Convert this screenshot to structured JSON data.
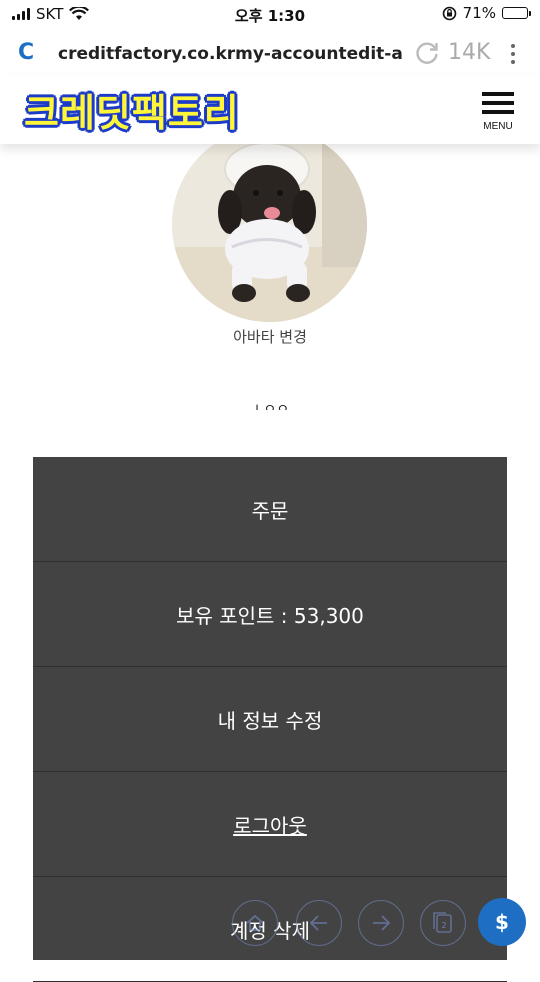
{
  "status_bar": {
    "carrier": "SKT",
    "time": "오후 1:30",
    "battery_percent": "71%",
    "battery_level": 0.71,
    "battery_color": "#3fc14b"
  },
  "browser": {
    "icon_letter": "C",
    "url": "creditfactory.co.krmy-accountedit-a",
    "tab_count": "14K",
    "reload_icon": "reload-icon",
    "more_icon": "more-vertical-icon"
  },
  "header": {
    "logo_text": "크레딧팩토리",
    "menu_label": "MENU"
  },
  "profile": {
    "avatar_label": "아바타 변경",
    "partial_text": "ㅗㅇㅇ"
  },
  "menu": {
    "items": [
      {
        "label": "주문"
      },
      {
        "label": "보유 포인트 : 53,300"
      },
      {
        "label": "내 정보 수정"
      },
      {
        "label": "로그아웃"
      },
      {
        "label": "계정 삭제"
      }
    ]
  },
  "toolbar": {
    "tabs_count": "2",
    "pay_symbol": "$"
  },
  "colors": {
    "panel_bg": "#434343",
    "accent_blue": "#1e6fc4",
    "logo_yellow": "#fff63a",
    "logo_outline": "#1d3bc9"
  }
}
